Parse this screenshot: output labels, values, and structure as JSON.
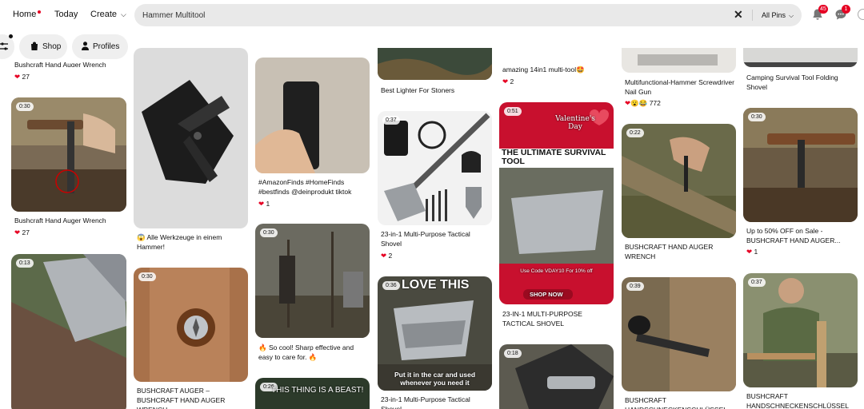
{
  "nav": {
    "home": "Home",
    "today": "Today",
    "create": "Create"
  },
  "search": {
    "value": "Hammer Multitool",
    "scope": "All Pins"
  },
  "notifications": {
    "count": "45"
  },
  "messages": {
    "count": "1"
  },
  "filters": {
    "shop": "Shop",
    "profiles": "Profiles"
  },
  "colors": {
    "accent": "#e60023",
    "search_bg": "#e9e9e9"
  },
  "pins": {
    "c1_top": {
      "title": "Bushcraft Hand Auger Wrench",
      "likes": "27"
    },
    "c1_a": {
      "duration": "0:30",
      "title": "Bushcraft Hand Auger Wrench",
      "likes": "27"
    },
    "c1_b": {
      "duration": "0:13"
    },
    "c2_a": {
      "title": "😱 Alle Werkzeuge in einem Hammer!"
    },
    "c2_b": {
      "duration": "0:30",
      "title": "BUSHCRAFT AUGER – BUSHCRAFT HAND AUGER WRENCH"
    },
    "c3_a": {
      "title": "#AmazonFinds #HomeFinds #bestfinds @deinprodukt tiktok",
      "likes": "1"
    },
    "c3_b": {
      "duration": "0:30",
      "title": "🔥 So cool! Sharp effective and easy to care for. 🔥"
    },
    "c3_c": {
      "duration": "0:26",
      "overlay": "THIS THING IS A BEAST!"
    },
    "c4_top": {
      "title": "Best Lighter For Stoners"
    },
    "c4_a": {
      "duration": "0:37",
      "title": "23-in-1 Multi-Purpose Tactical Shovel",
      "likes": "2"
    },
    "c4_b": {
      "duration": "0:36",
      "overlay_top": "LOVE THIS",
      "overlay_bottom": "Put it in the car and used whenever you need it",
      "title": "23-in-1 Multi-Purpose Tactical Shovel"
    },
    "c5_top": {
      "title": "amazing 14in1 multi-tool🤩",
      "likes": "2"
    },
    "c5_a": {
      "duration": "0:51",
      "banner": "THE ULTIMATE SURVIVAL TOOL",
      "valentine": "Valentine's Day",
      "code": "Use Code VDAY10 For 10% off",
      "shop_now": "SHOP NOW",
      "title": "23-IN-1 MULTI-PURPOSE TACTICAL SHOVEL"
    },
    "c5_b": {
      "duration": "0:18"
    },
    "c6_top": {
      "title": "Multifunctional-Hammer Screwdriver Nail Gun",
      "likes": "772"
    },
    "c6_a": {
      "duration": "0:22",
      "title": "BUSHCRAFT HAND AUGER WRENCH"
    },
    "c6_b": {
      "duration": "0:39",
      "title": "BUSHCRAFT HANDSCHNECKENSCHLÜSSEL"
    },
    "c7_top": {
      "title": "Camping Survival Tool Folding Shovel"
    },
    "c7_a": {
      "duration": "0:30",
      "title": "Up to 50% OFF on Sale - BUSHCRAFT HAND AUGER...",
      "likes": "1"
    },
    "c7_b": {
      "duration": "0:37",
      "title": "BUSHCRAFT HANDSCHNECKENSCHLÜSSEL"
    }
  }
}
